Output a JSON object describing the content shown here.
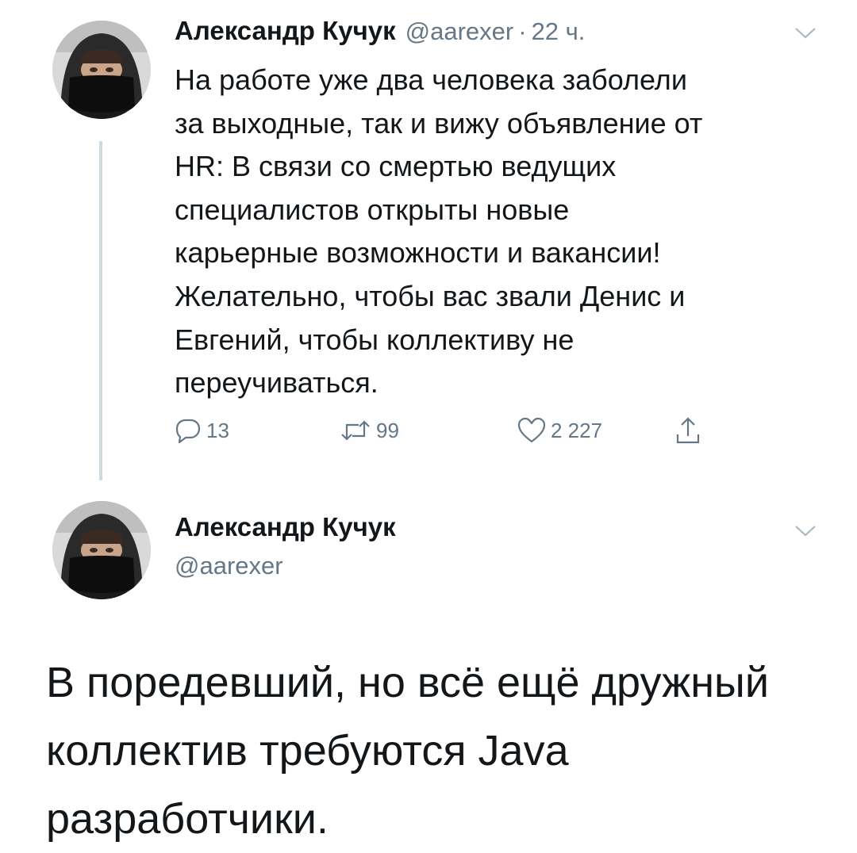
{
  "tweet1": {
    "author_name": "Александр Кучук",
    "handle": "@aarexer",
    "separator": "·",
    "time": "22 ч.",
    "text": "На работе уже два человека заболели\nза выходные, так и вижу объявление от\nHR: В связи со смертью ведущих\nспециалистов открыты новые\nкарьерные возможности и вакансии!\nЖелательно, чтобы вас звали Денис и\nЕвгений, чтобы коллективу не\nпереучиваться.",
    "replies": "13",
    "retweets": "99",
    "likes": "2 227",
    "icons": {
      "avatar": "avatar-photo",
      "menu": "chevron-down-icon",
      "reply": "reply-icon",
      "retweet": "retweet-icon",
      "like": "heart-icon",
      "share": "share-icon"
    }
  },
  "tweet2": {
    "author_name": "Александр Кучук",
    "handle": "@aarexer",
    "text": "В поредевший, но всё ещё дружный\nколлектив требуются Java\nразработчики."
  },
  "colors": {
    "text": "#14171a",
    "secondary": "#657786",
    "thread_line": "#cfd9de",
    "background": "#ffffff"
  }
}
